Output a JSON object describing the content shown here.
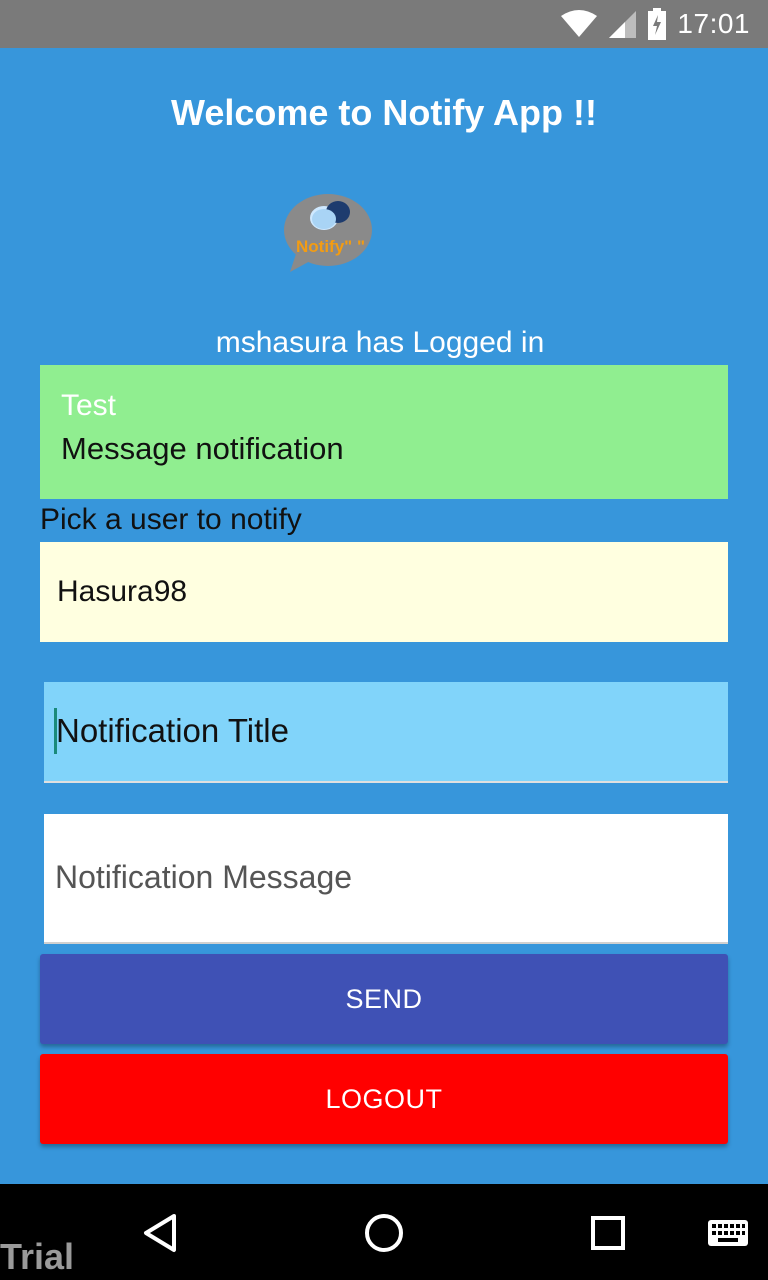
{
  "status_bar": {
    "time": "17:01",
    "icons": [
      "wifi-icon",
      "signal-icon",
      "battery-icon"
    ]
  },
  "header": {
    "title": "Welcome to Notify App !!"
  },
  "logo": {
    "text": "Notify\" \""
  },
  "session": {
    "logged_in_text": "mshasura has Logged in"
  },
  "notification": {
    "title": "Test",
    "message": "Message notification"
  },
  "picker": {
    "label": "Pick a user to notify",
    "selected": "Hasura98"
  },
  "form": {
    "title_value": "Notification Title",
    "message_placeholder": "Notification Message"
  },
  "buttons": {
    "send": "SEND",
    "logout": "LOGOUT"
  },
  "nav": {
    "icons": [
      "back-icon",
      "home-icon",
      "recents-icon",
      "keyboard-icon"
    ]
  },
  "watermark": "Trial",
  "colors": {
    "background": "#3796DB",
    "notification_card": "#90EE90",
    "picker": "#FFFFE0",
    "title_input": "#81D4FA",
    "send_button": "#3F51B5",
    "logout_button": "#FF0000"
  }
}
